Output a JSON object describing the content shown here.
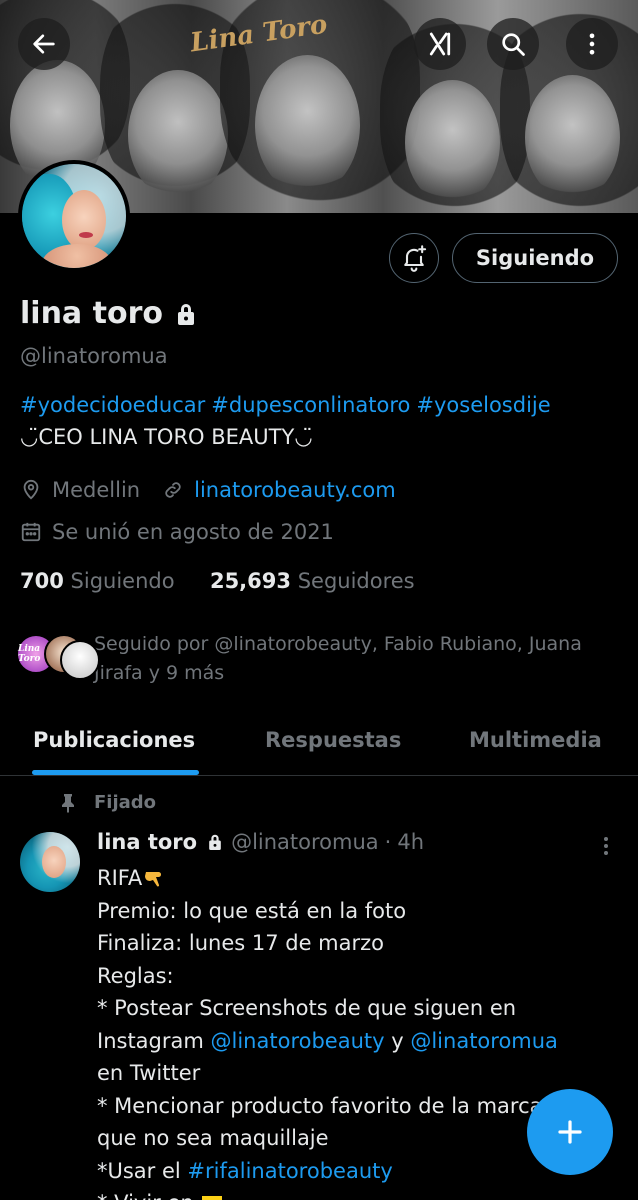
{
  "header": {
    "banner_logo_text": "Lina Toro"
  },
  "profile": {
    "name": "lina toro",
    "handle": "@linatoromua",
    "follow_button": "Siguiendo",
    "bio_hashtags": [
      "#yodecidoeducar",
      "#dupesconlinatoro",
      "#yoselosdije"
    ],
    "bio_line": "◡̈CEO LINA TORO BEAUTY◡̈",
    "location": "Medellin",
    "website": "linatorobeauty.com",
    "joined": "Se unió en agosto de 2021",
    "following_count": "700",
    "following_label": "Siguiendo",
    "followers_count": "25,693",
    "followers_label": "Seguidores",
    "followed_by": "Seguido por @linatorobeauty, Fabio Rubiano, Juana Jirafa y 9 más",
    "followed_by_logo_text": "Lina Toro"
  },
  "tabs": [
    {
      "label": "Publicaciones",
      "active": true
    },
    {
      "label": "Respuestas",
      "active": false
    },
    {
      "label": "Multimedia",
      "active": false
    }
  ],
  "post": {
    "pinned_label": "Fijado",
    "author_name": "lina toro",
    "author_handle": "@linatoromua",
    "separator": "·",
    "time": "4h",
    "lines": {
      "l1": "RIFA",
      "l2": "Premio: lo que está en la foto",
      "l3": "Finaliza: lunes 17 de marzo",
      "l4": "Reglas:",
      "l5": "* Postear Screenshots de que siguen en",
      "l6_a": "Instagram ",
      "l6_m1": "@linatorobeauty",
      "l6_b": " y ",
      "l6_m2": "@linatoromua",
      "l7": "en Twitter",
      "l8": "* Mencionar producto favorito de la marca",
      "l9": "que no sea maquillaje",
      "l10_a": "*Usar el ",
      "l10_tag": "#rifalinatorobeauty",
      "l11": "* Vivir en "
    }
  },
  "colors": {
    "accent": "#1d9bf0",
    "text_primary": "#e7e9ea",
    "text_secondary": "#71767b",
    "background": "#000000"
  }
}
